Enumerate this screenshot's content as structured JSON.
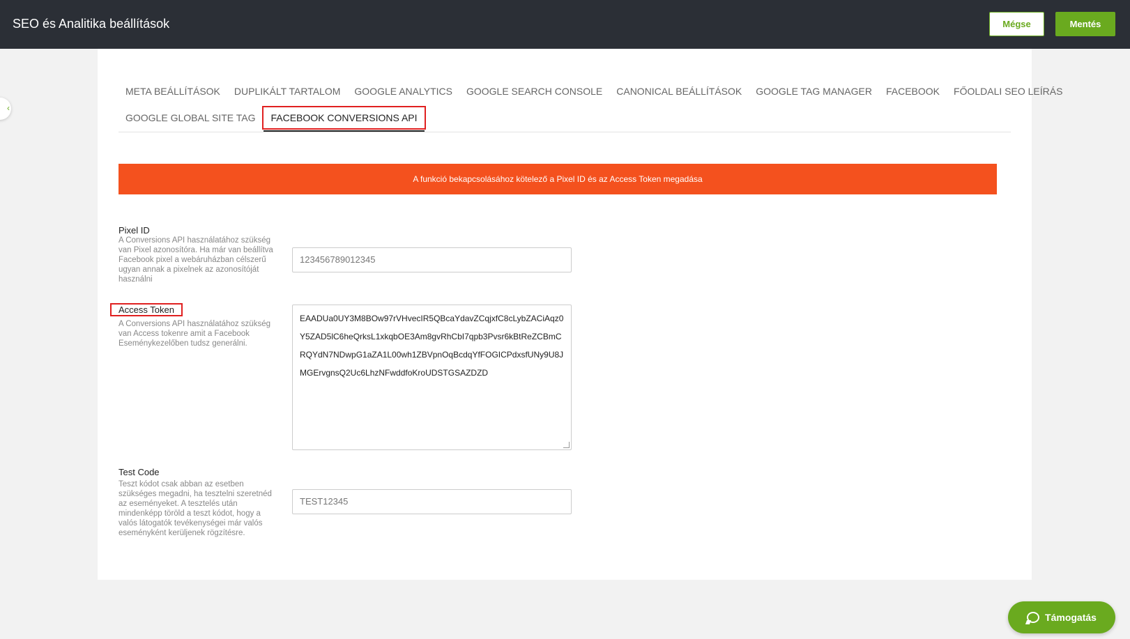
{
  "header": {
    "title": "SEO és Analitika beállítások",
    "cancel_label": "Mégse",
    "save_label": "Mentés"
  },
  "tabs": {
    "row1": [
      "META BEÁLLÍTÁSOK",
      "DUPLIKÁLT TARTALOM",
      "GOOGLE ANALYTICS",
      "GOOGLE SEARCH CONSOLE",
      "CANONICAL BEÁLLÍTÁSOK",
      "GOOGLE TAG MANAGER",
      "FACEBOOK",
      "FŐOLDALI SEO LEÍRÁS"
    ],
    "row2": [
      "GOOGLE GLOBAL SITE TAG",
      "FACEBOOK CONVERSIONS API"
    ],
    "active": "FACEBOOK CONVERSIONS API"
  },
  "alert": {
    "text": "A funkció bekapcsolásához kötelező a Pixel ID és az Access Token megadása"
  },
  "fields": {
    "pixel_id": {
      "label": "Pixel ID",
      "help": "A Conversions API használatához szükség van Pixel azonosítóra. Ha már van beállítva Facebook pixel a webáruházban célszerű ugyan annak a pixelnek az azonosítóját használni",
      "value": "123456789012345"
    },
    "access_token": {
      "label": "Access Token",
      "help": "A Conversions API használatához szükség van Access tokenre amit a Facebook Eseménykezelőben tudsz generálni.",
      "value": "EAADUa0UY3M8BOw97rVHvecIR5QBcaYdavZCqjxfC8cLybZACiAqz0Y5ZAD5lC6heQrksL1xkqbOE3Am8gvRhCbI7qpb3Pvsr6kBtReZCBmCRQYdN7NDwpG1aZA1L00wh1ZBVpnOqBcdqYfFOGICPdxsfUNy9U8JMGErvgnsQ2Uc6LhzNFwddfoKroUDSTGSAZDZD"
    },
    "test_code": {
      "label": "Test Code",
      "help": "Teszt kódot csak abban az esetben szükséges megadni, ha tesztelni szeretnéd az eseményeket. A tesztelés után mindenképp töröld a teszt kódot, hogy a valós látogatók tevékenységei már valós eseményként kerüljenek rögzítésre.",
      "value": "TEST12345"
    }
  },
  "support": {
    "label": "Támogatás"
  },
  "colors": {
    "brand_green": "#6aaa1f",
    "header_bg": "#2b2f36",
    "alert_orange": "#f4511e",
    "highlight_red": "#e02020"
  }
}
